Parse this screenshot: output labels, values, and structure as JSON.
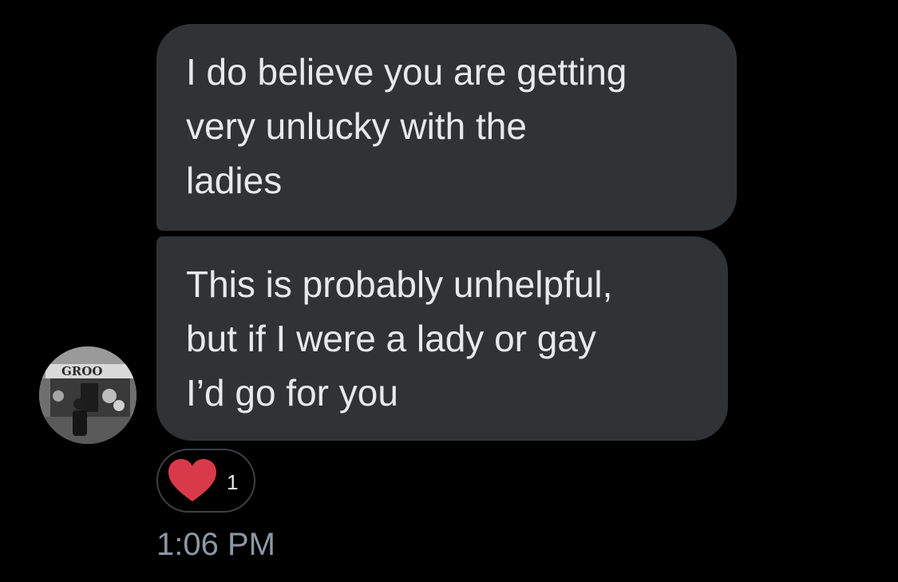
{
  "messages": [
    {
      "text": "I do believe you are getting\nvery unlucky with the\nladies"
    },
    {
      "text": "This is probably unhelpful,\nbut if I were a lady or gay\nI’d go for you"
    }
  ],
  "reaction": {
    "icon": "heart-icon",
    "count": "1",
    "color": "#d83a4a"
  },
  "timestamp": "1:06 PM",
  "avatar": {
    "sign_text": "GROO"
  },
  "colors": {
    "background": "#000000",
    "bubble": "#2f3336",
    "text": "#e7e9ea",
    "muted": "#8b98a5"
  }
}
